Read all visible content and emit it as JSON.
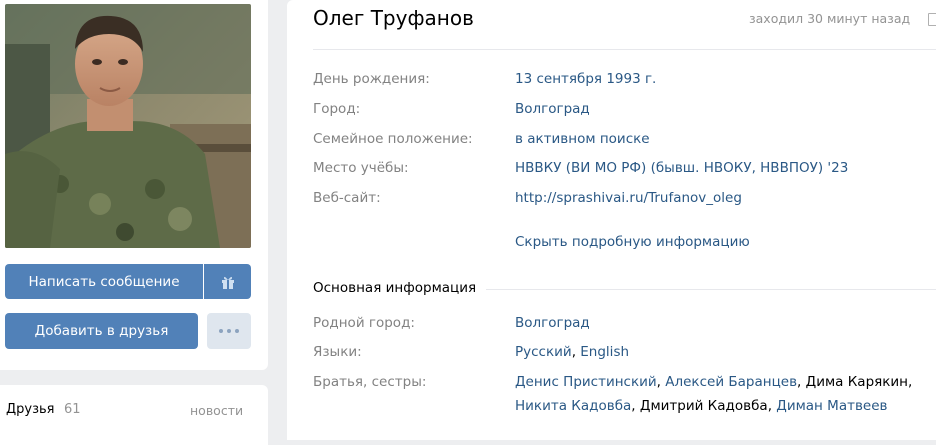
{
  "profile": {
    "name": "Олег Труфанов",
    "last_seen": "заходил 30 минут назад"
  },
  "actions": {
    "message_label": "Написать сообщение",
    "add_friend_label": "Добавить в друзья"
  },
  "details": {
    "birthday_label": "День рождения:",
    "birthday_value": "13 сентября 1993 г.",
    "city_label": "Город:",
    "city_value": "Волгоград",
    "family_label": "Семейное положение:",
    "family_value": "в активном поиске",
    "study_label": "Место учёбы:",
    "study_value": "НВВКУ (ВИ МО РФ) (бывш. НВОКУ, НВВПОУ) '23",
    "website_label": "Веб-сайт:",
    "website_value": "http://sprashivai.ru/Trufanov_oleg",
    "hide_link": "Скрыть подробную информацию"
  },
  "basic": {
    "section_title": "Основная информация",
    "hometown_label": "Родной город:",
    "hometown_value": "Волгоград",
    "languages_label": "Языки:",
    "languages": [
      "Русский",
      "English"
    ],
    "siblings_label": "Братья, сестры:",
    "siblings": [
      {
        "name": "Денис Пристинский",
        "link": true
      },
      {
        "name": "Алексей Баранцев",
        "link": true
      },
      {
        "name": "Дима Карякин",
        "link": false
      },
      {
        "name": "Никита Кадовба",
        "link": true
      },
      {
        "name": "Дмитрий Кадовба",
        "link": false
      },
      {
        "name": "Диман Матвеев",
        "link": true
      }
    ]
  },
  "friends": {
    "label": "Друзья",
    "count": "61",
    "news": "новости"
  },
  "icons": {
    "gift": "gift-icon",
    "more": "more-icon",
    "device": "device-icon"
  },
  "colors": {
    "accent": "#5181b8",
    "link": "#2a5885",
    "muted": "#828282",
    "background": "#edeef0"
  }
}
